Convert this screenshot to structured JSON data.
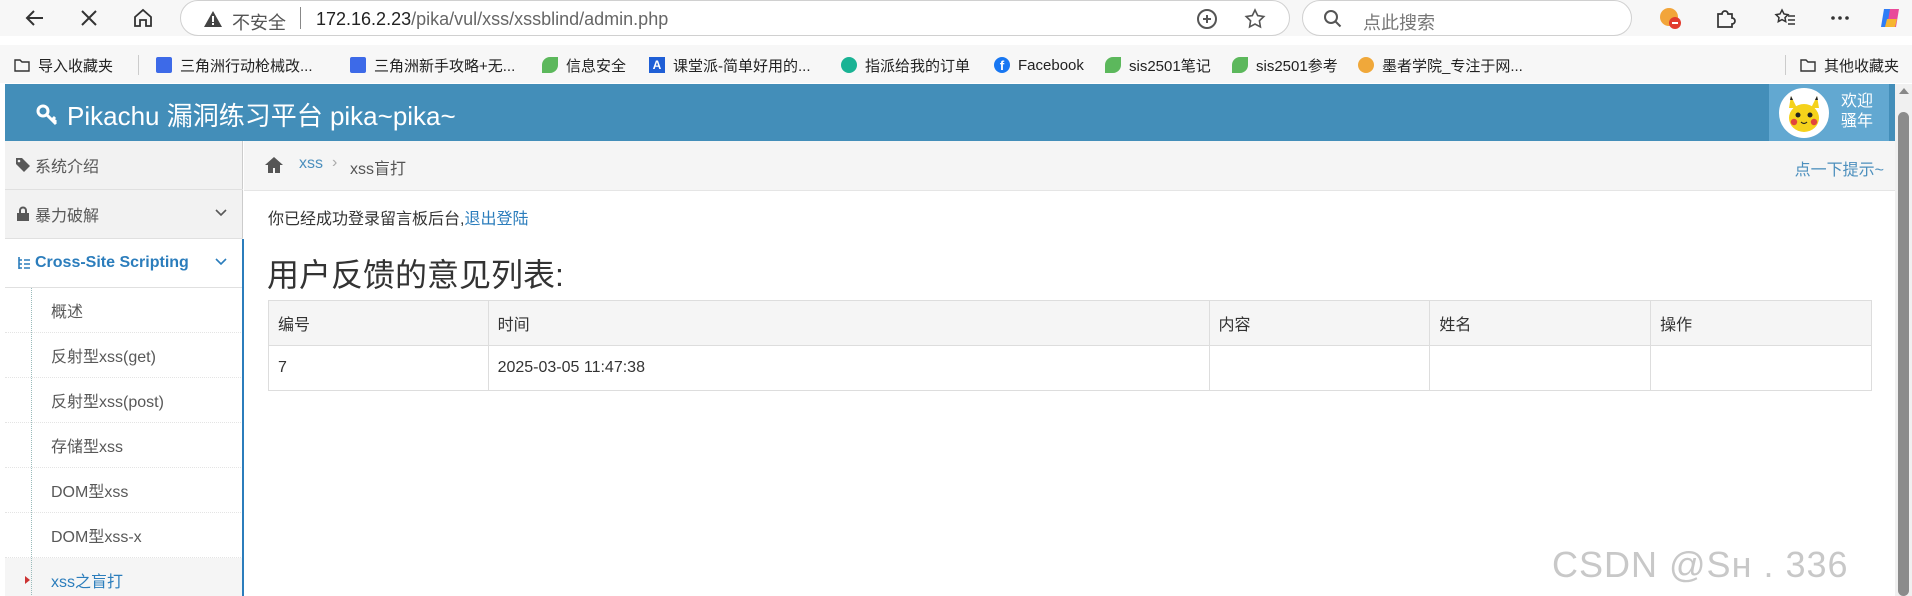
{
  "browser": {
    "insecure_label": "不安全",
    "url_host": "172.16.2.23",
    "url_path": "/pika/vul/xss/xssblind/admin.php",
    "search_placeholder": "点此搜索"
  },
  "bookmarks": [
    {
      "label": "导入收藏夹",
      "icon": "folder-icon"
    },
    {
      "label": "三角洲行动枪械改...",
      "icon": "doc-icon"
    },
    {
      "label": "三角洲新手攻略+无...",
      "icon": "doc-icon"
    },
    {
      "label": "信息安全",
      "icon": "leaf-icon"
    },
    {
      "label": "课堂派-简单好用的...",
      "icon": "ketangpai-icon"
    },
    {
      "label": "指派给我的订单",
      "icon": "bolt-icon"
    },
    {
      "label": "Facebook",
      "icon": "facebook-icon"
    },
    {
      "label": "sis2501笔记",
      "icon": "leaf-icon"
    },
    {
      "label": "sis2501参考",
      "icon": "leaf-icon"
    },
    {
      "label": "墨者学院_专注于网...",
      "icon": "cloud-icon"
    }
  ],
  "other_bookmarks": "其他收藏夹",
  "header": {
    "title": "Pikachu 漏洞练习平台 pika~pika~",
    "welcome_line1": "欢迎",
    "welcome_line2": "骚年"
  },
  "sidebar": {
    "items": [
      {
        "label": "系统介绍"
      },
      {
        "label": "暴力破解"
      },
      {
        "label": "Cross-Site Scripting"
      }
    ],
    "subitems": [
      {
        "label": "概述"
      },
      {
        "label": "反射型xss(get)"
      },
      {
        "label": "反射型xss(post)"
      },
      {
        "label": "存储型xss"
      },
      {
        "label": "DOM型xss"
      },
      {
        "label": "DOM型xss-x"
      },
      {
        "label": "xss之盲打"
      }
    ]
  },
  "breadcrumb": {
    "parent": "xss",
    "current": "xss盲打",
    "hint": "点一下提示~"
  },
  "content": {
    "login_msg": "你已经成功登录留言板后台,",
    "logout_link": "退出登陆",
    "list_title": "用户反馈的意见列表:",
    "table": {
      "headers": [
        "编号",
        "时间",
        "内容",
        "姓名",
        "操作"
      ],
      "rows": [
        [
          "7",
          "2025-03-05 11:47:38",
          "",
          "",
          ""
        ]
      ]
    }
  },
  "watermark": "CSDN @Sн     .  336",
  "colors": {
    "header": "#438eb9",
    "link": "#2b7dbc"
  }
}
